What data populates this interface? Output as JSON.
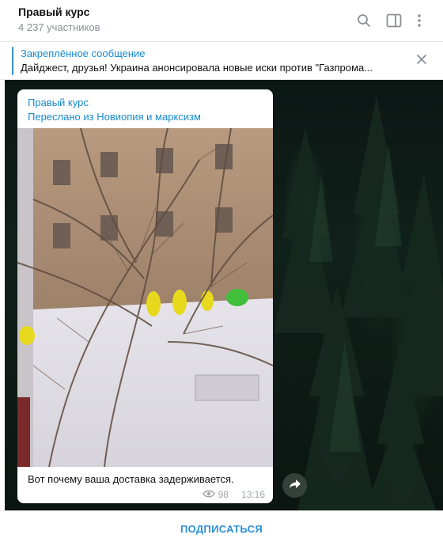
{
  "header": {
    "title": "Правый курс",
    "subtitle": "4 237 участников",
    "icons": [
      "search-icon",
      "sidebar-toggle-icon",
      "more-vertical-icon"
    ]
  },
  "pinned": {
    "title": "Закреплённое сообщение",
    "text": "Дайджест, друзья!  Украина анонсировала новые иски против \"Газпрома...",
    "close_icon": "close-icon"
  },
  "message": {
    "author": "Правый курс",
    "forwarded": "Переслано из Новиопия и марксизм",
    "caption": "Вот почему ваша доставка задерживается.",
    "views": "98",
    "time": "13:16",
    "views_icon": "eye-icon",
    "share_icon": "share-icon"
  },
  "footer": {
    "subscribe_label": "ПОДПИСАТЬСЯ"
  },
  "colors": {
    "accent": "#168acd",
    "subscribe": "#2b8fd6",
    "chat_background": "#0f1d18"
  }
}
